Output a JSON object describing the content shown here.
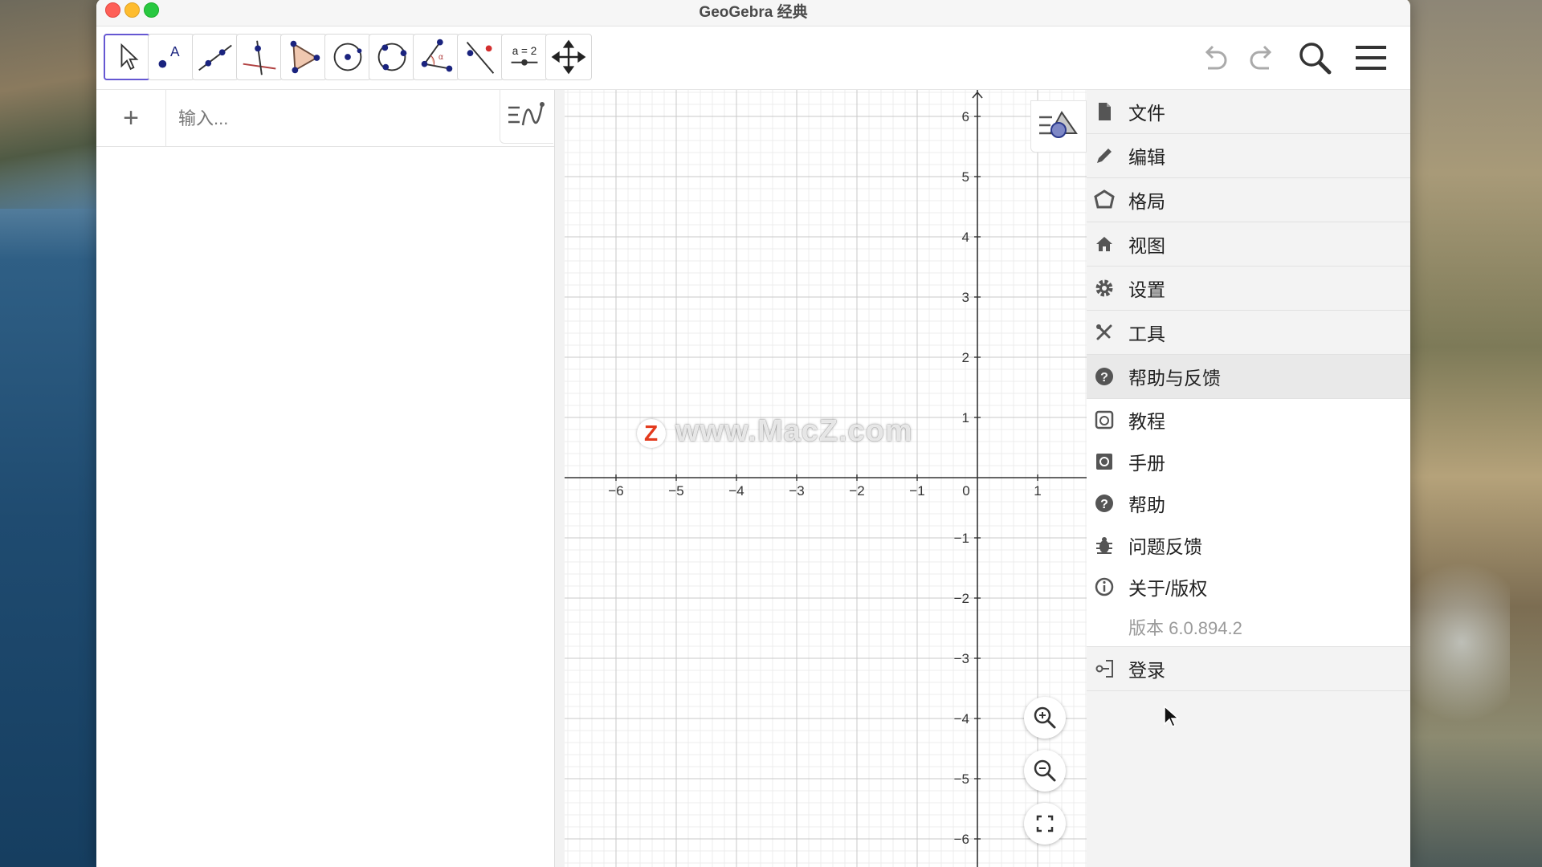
{
  "window": {
    "title": "GeoGebra 经典"
  },
  "toolbar": {
    "tools": [
      {
        "name": "move-tool"
      },
      {
        "name": "point-tool"
      },
      {
        "name": "line-tool"
      },
      {
        "name": "perpendicular-line-tool"
      },
      {
        "name": "polygon-tool"
      },
      {
        "name": "circle-center-point-tool"
      },
      {
        "name": "circle-three-points-tool"
      },
      {
        "name": "angle-tool"
      },
      {
        "name": "reflect-tool"
      },
      {
        "name": "slider-tool"
      },
      {
        "name": "move-graphics-tool"
      }
    ],
    "slider_label": "a = 2",
    "point_label": "A",
    "angle_label": "α"
  },
  "algebra": {
    "plus": "+",
    "input_placeholder": "输入..."
  },
  "graphics": {
    "x_ticks": [
      "−6",
      "−5",
      "−4",
      "−3",
      "−2",
      "−1",
      "0",
      "1"
    ],
    "y_ticks": [
      "6",
      "5",
      "4",
      "3",
      "2",
      "1",
      "−1",
      "−2",
      "−3",
      "−4",
      "−5",
      "−6"
    ]
  },
  "watermark": {
    "z": "Z",
    "text": "www.MacZ.com"
  },
  "menu": {
    "items": [
      {
        "label": "文件",
        "icon": "file-icon"
      },
      {
        "label": "编辑",
        "icon": "pencil-icon"
      },
      {
        "label": "格局",
        "icon": "perspective-icon"
      },
      {
        "label": "视图",
        "icon": "home-icon"
      },
      {
        "label": "设置",
        "icon": "gear-icon"
      },
      {
        "label": "工具",
        "icon": "tools-icon"
      },
      {
        "label": "帮助与反馈",
        "icon": "help-icon"
      }
    ],
    "help_sub": [
      {
        "label": "教程",
        "icon": "tutorial-icon"
      },
      {
        "label": "手册",
        "icon": "manual-icon"
      },
      {
        "label": "帮助",
        "icon": "help-icon"
      },
      {
        "label": "问题反馈",
        "icon": "bug-icon"
      },
      {
        "label": "关于/版权",
        "icon": "info-icon"
      }
    ],
    "version": "版本 6.0.894.2",
    "login": "登录"
  },
  "colors": {
    "accent": "#6557d2",
    "menu_bg": "#f3f3f3",
    "grid_major": "#c8c8c8",
    "grid_minor": "#ececec"
  }
}
